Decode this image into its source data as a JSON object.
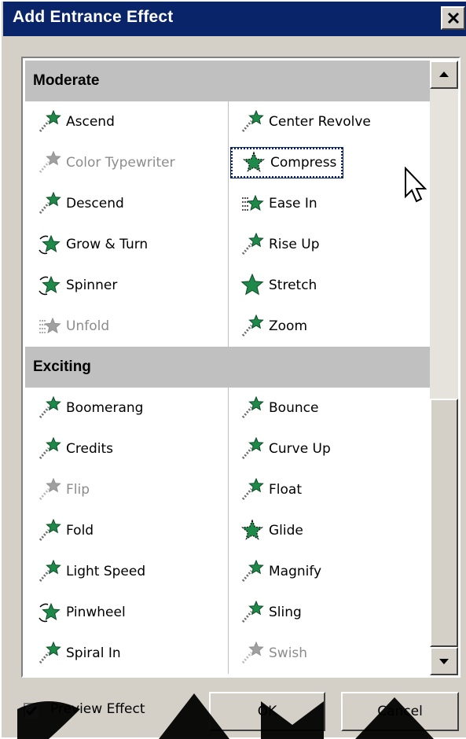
{
  "window": {
    "title": "Add Entrance Effect",
    "close_symbol": "✕"
  },
  "colors": {
    "titlebar": "#0a246a",
    "icon_green": "#1e8a4a",
    "disabled_text": "#8c8c8c"
  },
  "sections": [
    {
      "header": "Moderate",
      "items": [
        {
          "label": "Ascend",
          "icon": "star-trail-icon",
          "disabled": false
        },
        {
          "label": "Center Revolve",
          "icon": "star-trail-icon",
          "disabled": false
        },
        {
          "label": "Color Typewriter",
          "icon": "star-trail-icon",
          "disabled": true
        },
        {
          "label": "Compress",
          "icon": "star-burst-icon",
          "disabled": false,
          "selected": true
        },
        {
          "label": "Descend",
          "icon": "star-trail-icon",
          "disabled": false
        },
        {
          "label": "Ease In",
          "icon": "star-ease-icon",
          "disabled": false
        },
        {
          "label": "Grow & Turn",
          "icon": "star-spin-icon",
          "disabled": false
        },
        {
          "label": "Rise Up",
          "icon": "star-trail-icon",
          "disabled": false
        },
        {
          "label": "Spinner",
          "icon": "star-spin-icon",
          "disabled": false
        },
        {
          "label": "Stretch",
          "icon": "star-solid-icon",
          "disabled": false
        },
        {
          "label": "Unfold",
          "icon": "star-ease-icon",
          "disabled": true
        },
        {
          "label": "Zoom",
          "icon": "star-trail-icon",
          "disabled": false
        }
      ]
    },
    {
      "header": "Exciting",
      "items": [
        {
          "label": "Boomerang",
          "icon": "star-trail-icon",
          "disabled": false
        },
        {
          "label": "Bounce",
          "icon": "star-trail-icon",
          "disabled": false
        },
        {
          "label": "Credits",
          "icon": "star-trail-icon",
          "disabled": false
        },
        {
          "label": "Curve Up",
          "icon": "star-trail-icon",
          "disabled": false
        },
        {
          "label": "Flip",
          "icon": "star-trail-icon",
          "disabled": true
        },
        {
          "label": "Float",
          "icon": "star-trail-icon",
          "disabled": false
        },
        {
          "label": "Fold",
          "icon": "star-trail-icon",
          "disabled": false
        },
        {
          "label": "Glide",
          "icon": "star-burst-icon",
          "disabled": false
        },
        {
          "label": "Light Speed",
          "icon": "star-trail-icon",
          "disabled": false
        },
        {
          "label": "Magnify",
          "icon": "star-trail-icon",
          "disabled": false
        },
        {
          "label": "Pinwheel",
          "icon": "star-spin-icon",
          "disabled": false
        },
        {
          "label": "Sling",
          "icon": "star-trail-icon",
          "disabled": false
        },
        {
          "label": "Spiral In",
          "icon": "star-trail-icon",
          "disabled": false
        },
        {
          "label": "Swish",
          "icon": "star-trail-icon",
          "disabled": true
        }
      ]
    }
  ],
  "footer": {
    "preview_label": "Preview Effect",
    "preview_checked": true,
    "ok_label": "OK",
    "cancel_label": "Cancel"
  }
}
